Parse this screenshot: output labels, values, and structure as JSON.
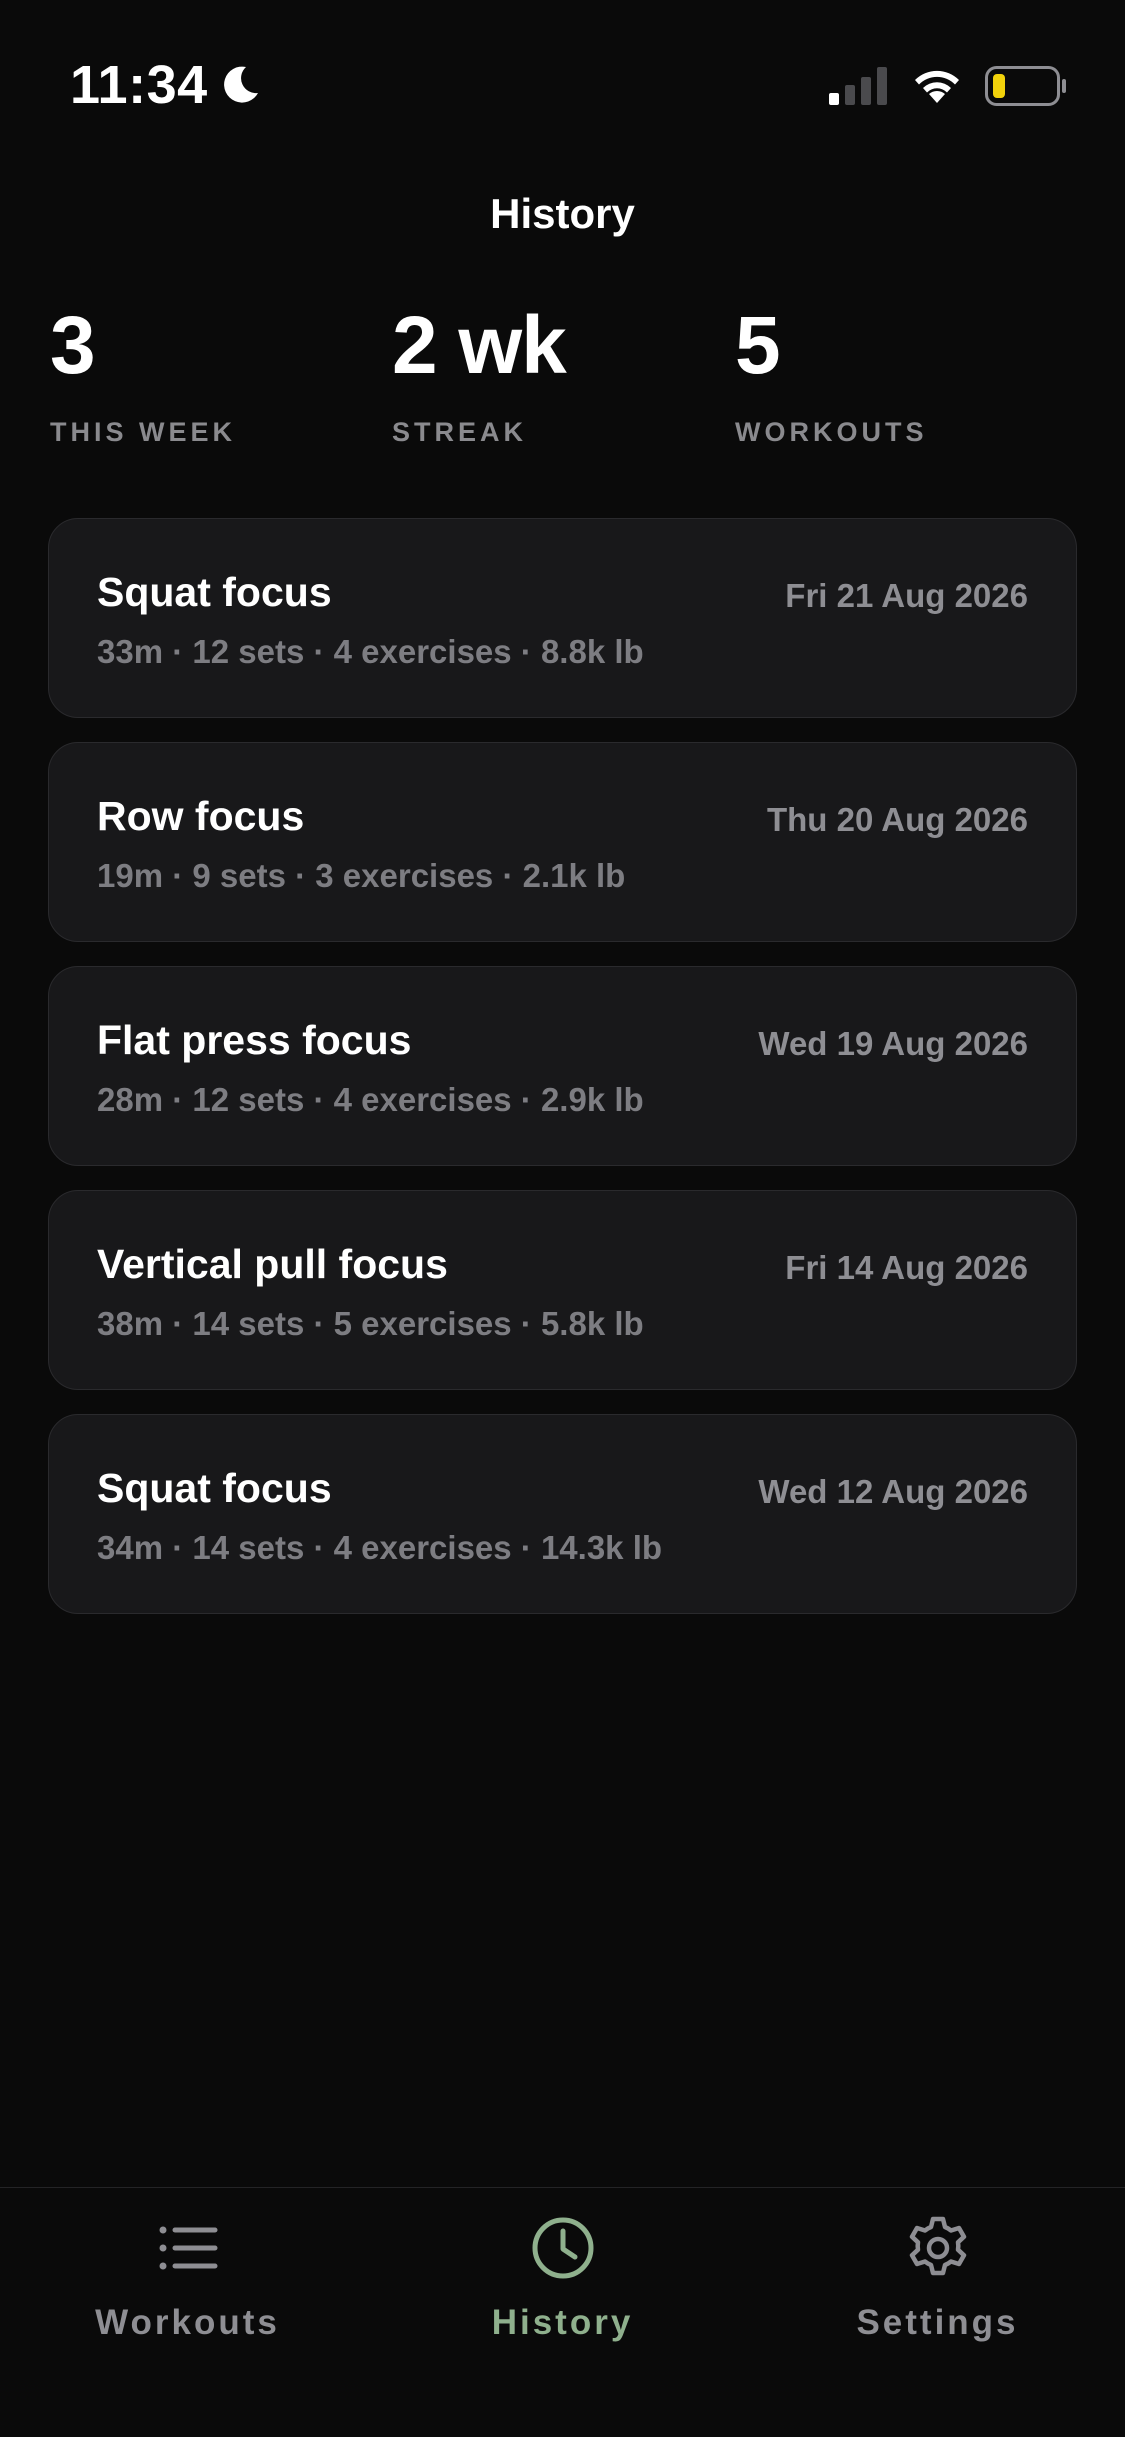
{
  "status_bar": {
    "time": "11:34",
    "icons": [
      "moon-icon",
      "signal-icon",
      "wifi-icon",
      "battery-icon"
    ],
    "battery_color": "#f2d20b"
  },
  "header": {
    "title": "History"
  },
  "stats": [
    {
      "value": "3",
      "label": "THIS WEEK"
    },
    {
      "value": "2 wk",
      "label": "STREAK"
    },
    {
      "value": "5",
      "label": "WORKOUTS"
    }
  ],
  "workouts": [
    {
      "title": "Squat focus",
      "date": "Fri 21 Aug 2026",
      "meta": "33m · 12 sets · 4 exercises · 8.8k lb"
    },
    {
      "title": "Row focus",
      "date": "Thu 20 Aug 2026",
      "meta": "19m · 9 sets · 3 exercises · 2.1k lb"
    },
    {
      "title": "Flat press focus",
      "date": "Wed 19 Aug 2026",
      "meta": "28m · 12 sets · 4 exercises · 2.9k lb"
    },
    {
      "title": "Vertical pull focus",
      "date": "Fri 14 Aug 2026",
      "meta": "38m · 14 sets · 5 exercises · 5.8k lb"
    },
    {
      "title": "Squat focus",
      "date": "Wed 12 Aug 2026",
      "meta": "34m · 14 sets · 4 exercises · 14.3k lb"
    }
  ],
  "tab_bar": {
    "tabs": [
      {
        "label": "Workouts",
        "icon": "list-icon",
        "active": false
      },
      {
        "label": "History",
        "icon": "clock-icon",
        "active": true
      },
      {
        "label": "Settings",
        "icon": "gear-icon",
        "active": false
      }
    ],
    "active_color": "#8fb08d",
    "inactive_color": "#8e8e93"
  }
}
